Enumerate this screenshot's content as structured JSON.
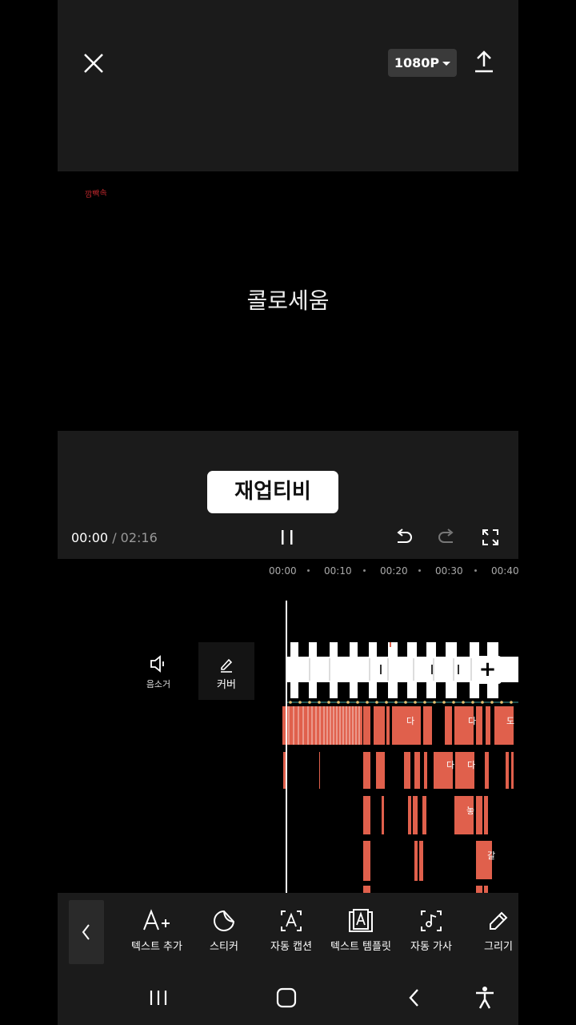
{
  "header": {
    "resolution": "1080P"
  },
  "preview": {
    "corner_label": "깜빡속",
    "center_text": "콜로세움"
  },
  "editor": {
    "overlay_text": "재업티비",
    "current_time": "00:00",
    "separator": " / ",
    "total_time": "02:16"
  },
  "ruler": [
    "00:00",
    "00:10",
    "00:20",
    "00:30",
    "00:40"
  ],
  "side": {
    "mute_label": "음소거",
    "cover_label": "커버"
  },
  "track_letters": [
    "다",
    "다",
    "도",
    "다",
    "다",
    "놓",
    "갈"
  ],
  "toolbar": {
    "items": [
      {
        "label": "텍스트 추가",
        "icon": "text-add-icon"
      },
      {
        "label": "스티커",
        "icon": "sticker-icon"
      },
      {
        "label": "자동 캡션",
        "icon": "auto-caption-icon"
      },
      {
        "label": "텍스트 템플릿",
        "icon": "text-template-icon"
      },
      {
        "label": "자동 가사",
        "icon": "auto-lyrics-icon"
      },
      {
        "label": "그리기",
        "icon": "draw-icon"
      }
    ]
  },
  "colors": {
    "clip": "#e0604c",
    "panel": "#1b1b1b",
    "accent_red": "#c0282d"
  }
}
